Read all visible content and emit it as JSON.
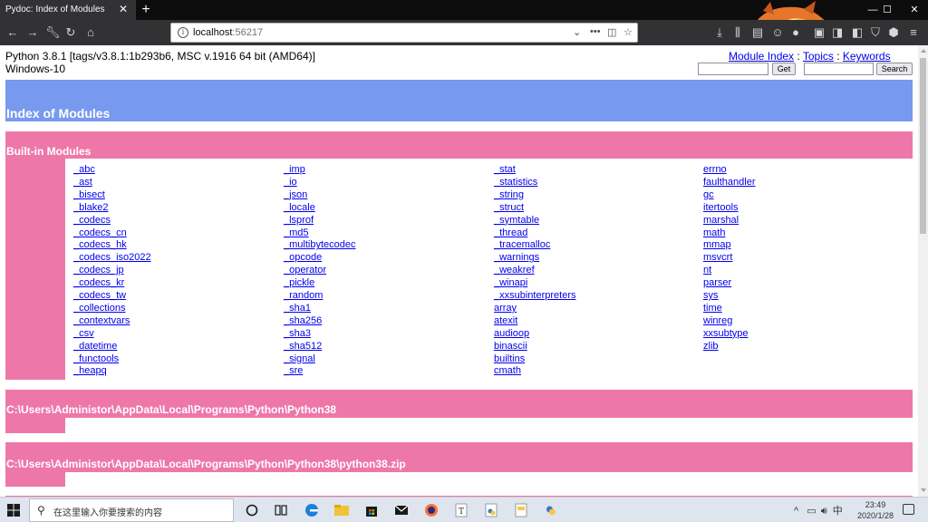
{
  "browser": {
    "tab_title": "Pydoc: Index of Modules",
    "new_tab_label": "+",
    "url_host": "localhost",
    "url_port": ":56217",
    "window_controls": {
      "minimize": "—",
      "maximize": "☐",
      "close": "✕"
    }
  },
  "page": {
    "sysinfo_line1": "Python 3.8.1 [tags/v3.8.1:1b293b6, MSC v.1916 64 bit (AMD64)]",
    "sysinfo_line2": "Windows-10",
    "links": {
      "module_index": "Module Index",
      "sep1": " : ",
      "topics": "Topics",
      "sep2": " : ",
      "keywords": "Keywords"
    },
    "get_button": "Get",
    "search_button": "Search",
    "heading": "Index of Modules",
    "builtin_header": "Built-in Modules",
    "builtin_columns": [
      [
        "_abc",
        "_ast",
        "_bisect",
        "_blake2",
        "_codecs",
        "_codecs_cn",
        "_codecs_hk",
        "_codecs_iso2022",
        "_codecs_jp",
        "_codecs_kr",
        "_codecs_tw",
        "_collections",
        "_contextvars",
        "_csv",
        "_datetime",
        "_functools",
        "_heapq"
      ],
      [
        "_imp",
        "_io",
        "_json",
        "_locale",
        "_lsprof",
        "_md5",
        "_multibytecodec",
        "_opcode",
        "_operator",
        "_pickle",
        "_random",
        "_sha1",
        "_sha256",
        "_sha3",
        "_sha512",
        "_signal",
        "_sre"
      ],
      [
        "_stat",
        "_statistics",
        "_string",
        "_struct",
        "_symtable",
        "_thread",
        "_tracemalloc",
        "_warnings",
        "_weakref",
        "_winapi",
        "_xxsubinterpreters",
        "array",
        "atexit",
        "audioop",
        "binascii",
        "builtins",
        "cmath"
      ],
      [
        "errno",
        "faulthandler",
        "gc",
        "itertools",
        "marshal",
        "math",
        "mmap",
        "msvcrt",
        "nt",
        "parser",
        "sys",
        "time",
        "winreg",
        "xxsubtype",
        "zlib"
      ]
    ],
    "path_section_1": "C:\\Users\\Administor\\AppData\\Local\\Programs\\Python\\Python38",
    "path_section_2": "C:\\Users\\Administor\\AppData\\Local\\Programs\\Python\\Python38\\python38.zip"
  },
  "taskbar": {
    "search_placeholder": "在这里输入你要搜索的内容",
    "tray_ime": "中",
    "clock_time": "23:49",
    "clock_date": "2020/1/28"
  },
  "colors": {
    "heading_bg": "#7799ee",
    "section_bg": "#ee77aa",
    "link": "#0000ee",
    "tab_active": "#323234",
    "tabbar": "#0c0c0d"
  }
}
